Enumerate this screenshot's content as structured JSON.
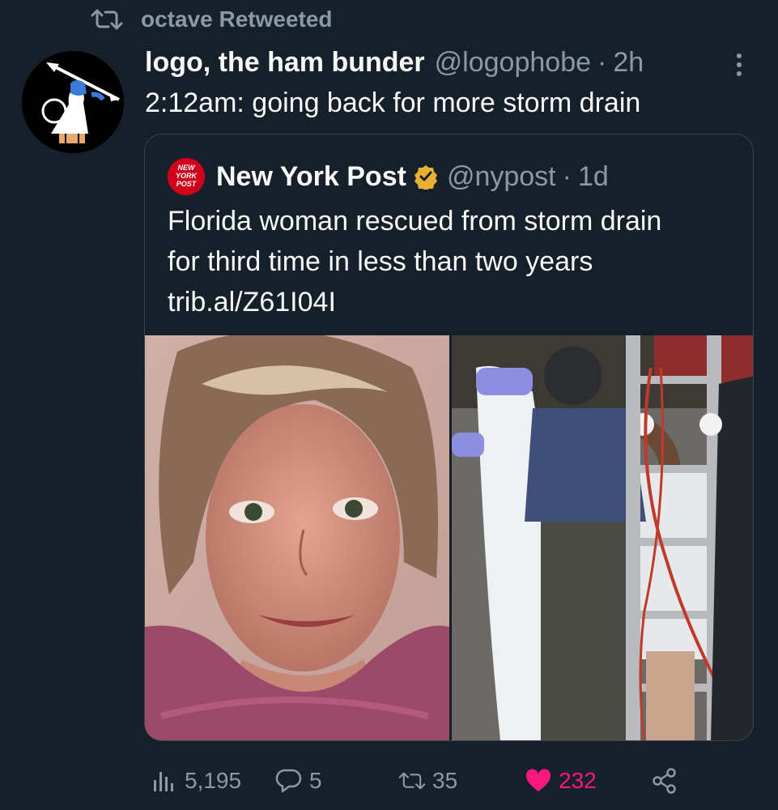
{
  "retweet": {
    "label": "octave Retweeted"
  },
  "tweet": {
    "name": "logo, the ham bunder",
    "handle": "@logophobe",
    "separator": "·",
    "time": "2h",
    "text": "2:12am: going back for more storm drain"
  },
  "quote": {
    "name": "New York Post",
    "handle": "@nypost",
    "separator": "·",
    "time": "1d",
    "lines": [
      "Florida woman rescued from storm drain",
      "for third time in less than two years",
      "trib.al/Z61I04I"
    ],
    "logo_text": [
      "NEW",
      "YORK",
      "POST"
    ]
  },
  "actions": {
    "views": "5,195",
    "replies": "5",
    "retweets": "35",
    "likes": "232"
  },
  "colors": {
    "background": "#15202b",
    "secondary_text": "#8b98a5",
    "like": "#f91880",
    "verified": "#e8b02e",
    "nyp_red": "#d0021b"
  }
}
